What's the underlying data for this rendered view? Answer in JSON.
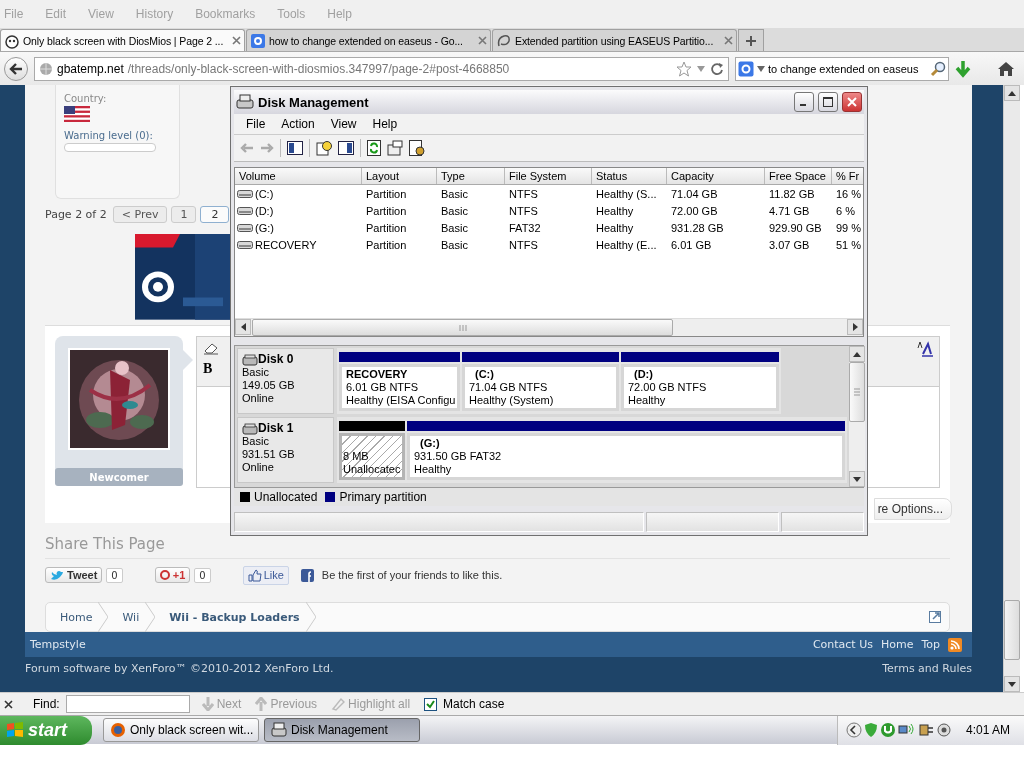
{
  "browser": {
    "menu": [
      "File",
      "Edit",
      "View",
      "History",
      "Bookmarks",
      "Tools",
      "Help"
    ],
    "tabs": [
      {
        "title": "Only black screen with DiosMios | Page 2 ...",
        "selected": true
      },
      {
        "title": "how to change extended on easeus - Go...",
        "selected": false
      },
      {
        "title": "Extended partition using EASEUS Partitio...",
        "selected": false
      }
    ],
    "url": {
      "host": "gbatemp.net",
      "path": "/threads/only-black-screen-with-diosmios.347997/page-2#post-4668850"
    },
    "search": {
      "value": "to change extended on easeus"
    }
  },
  "forum": {
    "user_card": {
      "country_label": "Country:",
      "warning_label": "Warning level (0):"
    },
    "page_nav": {
      "label": "Page 2 of 2",
      "prev": "< Prev",
      "pages": [
        {
          "label": "1",
          "selected": false
        },
        {
          "label": "2",
          "selected": true
        }
      ]
    },
    "reply": {
      "user_title": "Newcomer",
      "bold_button": "B",
      "more_options": "re Options..."
    },
    "share": {
      "heading": "Share This Page",
      "tweet": "Tweet",
      "tweet_count": "0",
      "plusone": "+1",
      "plusone_count": "0",
      "like": "Like",
      "like_text": "Be the first of your friends to like this."
    },
    "breadcrumb": [
      {
        "label": "Home",
        "current": false
      },
      {
        "label": "Wii",
        "current": false
      },
      {
        "label": "Wii - Backup Loaders",
        "current": true
      }
    ],
    "footer": {
      "style": "Tempstyle",
      "links": [
        "Contact Us",
        "Home",
        "Top"
      ],
      "copyright": "Forum software by XenForo™ ©2010-2012 XenForo Ltd.",
      "terms": "Terms and Rules"
    }
  },
  "disk_management": {
    "title": "Disk Management",
    "menu": [
      "File",
      "Action",
      "View",
      "Help"
    ],
    "columns": [
      "Volume",
      "Layout",
      "Type",
      "File System",
      "Status",
      "Capacity",
      "Free Space",
      "% Fr"
    ],
    "rows": [
      [
        "(C:)",
        "Partition",
        "Basic",
        "NTFS",
        "Healthy (S...",
        "71.04 GB",
        "11.82 GB",
        "16 %"
      ],
      [
        "(D:)",
        "Partition",
        "Basic",
        "NTFS",
        "Healthy",
        "72.00 GB",
        "4.71 GB",
        "6 %"
      ],
      [
        "(G:)",
        "Partition",
        "Basic",
        "FAT32",
        "Healthy",
        "931.28 GB",
        "929.90 GB",
        "99 %"
      ],
      [
        "RECOVERY",
        "Partition",
        "Basic",
        "NTFS",
        "Healthy (E...",
        "6.01 GB",
        "3.07 GB",
        "51 %"
      ]
    ],
    "disks": [
      {
        "name": "Disk 0",
        "type": "Basic",
        "size": "149.05 GB",
        "state": "Online",
        "partitions": [
          {
            "kind": "primary",
            "name": "RECOVERY",
            "size": "6.01 GB NTFS",
            "status": "Healthy (EISA Configu"
          },
          {
            "kind": "primary",
            "name": "(C:)",
            "size": "71.04 GB NTFS",
            "status": "Healthy (System)"
          },
          {
            "kind": "primary",
            "name": "(D:)",
            "size": "72.00 GB NTFS",
            "status": "Healthy"
          }
        ]
      },
      {
        "name": "Disk 1",
        "type": "Basic",
        "size": "931.51 GB",
        "state": "Online",
        "partitions": [
          {
            "kind": "unallocated",
            "size": "8 MB",
            "status": "Unallocatec"
          },
          {
            "kind": "primary",
            "name": "(G:)",
            "size": "931.50 GB FAT32",
            "status": "Healthy"
          }
        ]
      }
    ],
    "legend": [
      {
        "label": "Unallocated",
        "color": "#000000"
      },
      {
        "label": "Primary partition",
        "color": "#000080"
      }
    ]
  },
  "find_bar": {
    "label": "Find:",
    "buttons": [
      {
        "label": "Next",
        "disabled": true
      },
      {
        "label": "Previous",
        "disabled": true
      },
      {
        "label": "Highlight all",
        "disabled": true
      }
    ],
    "match_case": {
      "label": "Match case",
      "checked": true
    }
  },
  "taskbar": {
    "start": "start",
    "tasks": [
      {
        "label": "Only black screen wit...",
        "selected": false
      },
      {
        "label": "Disk Management",
        "selected": true
      }
    ],
    "clock": "4:01 AM"
  }
}
